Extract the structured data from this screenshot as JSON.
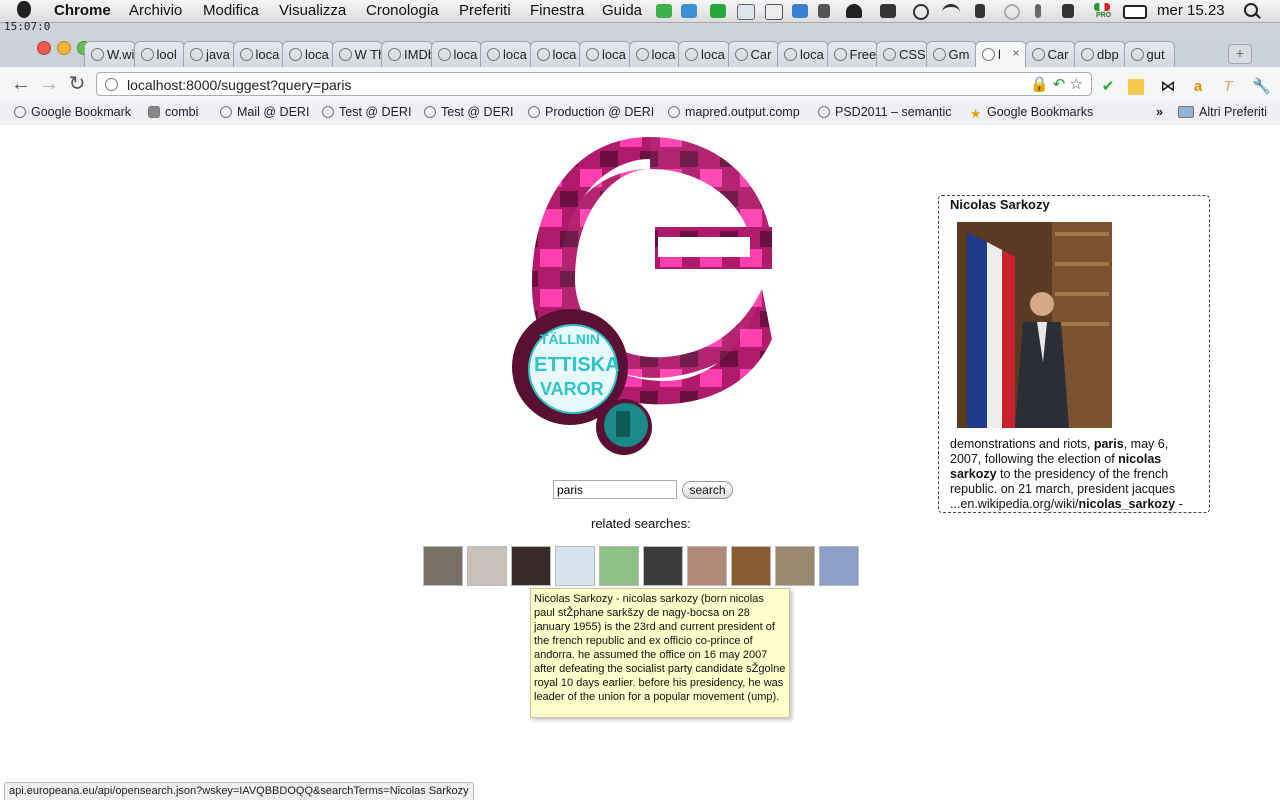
{
  "overlay_time": "15:07:0",
  "menubar": {
    "app": "Chrome",
    "menus": [
      "Archivio",
      "Modifica",
      "Visualizza",
      "Cronologia",
      "Preferiti",
      "Finestra",
      "Guida"
    ],
    "clock": "mer 15.23",
    "pro_label": "PRO"
  },
  "tabs": [
    {
      "label": "W.wik",
      "icon": "wikipedia-icon"
    },
    {
      "label": "lool",
      "icon": "globe-icon"
    },
    {
      "label": "java",
      "icon": "google-icon"
    },
    {
      "label": "loca",
      "icon": "globe-icon"
    },
    {
      "label": "loca",
      "icon": "globe-icon"
    },
    {
      "label": "W The",
      "icon": "wikipedia-icon"
    },
    {
      "label": "IMDb The",
      "icon": "imdb-icon"
    },
    {
      "label": "loca",
      "icon": "globe-icon"
    },
    {
      "label": "loca",
      "icon": "globe-icon"
    },
    {
      "label": "loca",
      "icon": "globe-icon"
    },
    {
      "label": "loca",
      "icon": "globe-icon"
    },
    {
      "label": "loca",
      "icon": "globe-icon"
    },
    {
      "label": "loca",
      "icon": "globe-icon"
    },
    {
      "label": "Car",
      "icon": "globe-icon"
    },
    {
      "label": "loca",
      "icon": "globe-icon"
    },
    {
      "label": "Free",
      "icon": "freemind-icon"
    },
    {
      "label": "CSS",
      "icon": "css-icon"
    },
    {
      "label": "Gm",
      "icon": "gmail-icon"
    },
    {
      "label": "l",
      "icon": "globe-icon",
      "active": true
    },
    {
      "label": "Car",
      "icon": "globe-icon"
    },
    {
      "label": "dbp",
      "icon": "google-icon"
    },
    {
      "label": "gut",
      "icon": "google-icon"
    }
  ],
  "toolbar": {
    "url": "localhost:8000/suggest?query=paris"
  },
  "bookmarks": {
    "items": [
      "Google Bookmark",
      "combi",
      "Mail @ DERI",
      "Test @ DERI",
      "Test @ DERI",
      "Production @ DERI",
      "mapred.output.comp",
      "PSD2011 – semantic",
      "Google Bookmarks"
    ],
    "overflow": "»",
    "other": "Altri Preferiti"
  },
  "search": {
    "value": "paris",
    "button_label": "search"
  },
  "related": {
    "label": "related searches:",
    "thumbs": [
      "#7a7066",
      "#c9c0b8",
      "#3a2a2a",
      "#d6e4f0",
      "#8cc084",
      "#3c3c3c",
      "#b08878",
      "#8a5a30",
      "#9a8870",
      "#8aa0c8"
    ]
  },
  "tooltip": {
    "text": "Nicolas Sarkozy - nicolas sarkozy (born nicolas paul stŽphane sarkšzy de nagy-bocsa on 28 january 1955) is the 23rd and current president of the french republic and ex officio co-prince of andorra. he assumed the office on 16 may 2007 after defeating the socialist party candidate sŽgolne royal 10 days earlier. before his presidency, he was leader of the union for a popular movement (ump)."
  },
  "infobox": {
    "title": "Nicolas Sarkozy",
    "snippet_1": "demonstrations and riots, ",
    "snippet_b1": "paris",
    "snippet_2": ", may 6, 2007, following the election of ",
    "snippet_b2": "nicolas sarkozy",
    "snippet_3": " to the presidency of the french republic. on 21 march, president jacques",
    "url_prefix": "...en.wikipedia.org/wiki/",
    "url_bold": "nicolas_sarkozy",
    "url_suffix": " -"
  },
  "statusbar": {
    "text": "api.europeana.eu/api/opensearch.json?wskey=IAVQBBDOQQ&searchTerms=Nicolas Sarkozy"
  },
  "colors": {
    "logo_magenta": "#e0208a",
    "logo_dark": "#6a1040",
    "logo_teal": "#2ec4c8",
    "tooltip_bg": "#ffffcc"
  }
}
